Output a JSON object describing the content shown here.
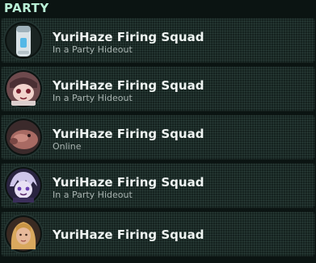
{
  "section_title": "PARTY",
  "members": [
    {
      "name": "YuriHaze Firing Squad",
      "status": "In a Party Hideout",
      "avatar_icon": "vape-device-avatar"
    },
    {
      "name": "YuriHaze Firing Squad",
      "status": "In a Party Hideout",
      "avatar_icon": "anime-character-avatar"
    },
    {
      "name": "YuriHaze Firing Squad",
      "status": "Online",
      "avatar_icon": "creature-avatar"
    },
    {
      "name": "YuriHaze Firing Squad",
      "status": "In a Party Hideout",
      "avatar_icon": "purple-anime-avatar"
    },
    {
      "name": "YuriHaze Firing Squad",
      "status": "",
      "avatar_icon": "blonde-portrait-avatar"
    }
  ],
  "colors": {
    "background": "#0b1412",
    "title": "#b9f0d6",
    "name": "#eef3f1",
    "status": "#a9b4b1",
    "row": "#15221f"
  }
}
